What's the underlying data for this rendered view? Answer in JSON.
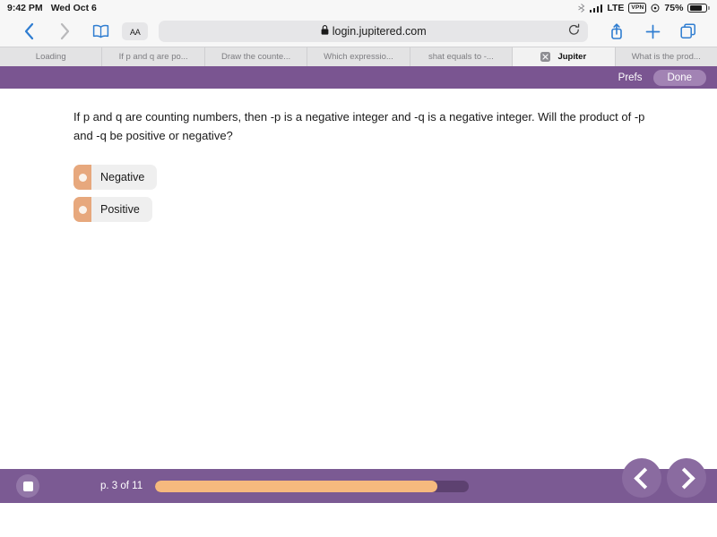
{
  "status_bar": {
    "time": "9:42 PM",
    "date": "Wed Oct 6",
    "network": "LTE",
    "vpn": "VPN",
    "battery_percent": "75%",
    "battery_level": 75
  },
  "browser": {
    "url": "login.jupitered.com",
    "text_size_label": "AA",
    "icons": {
      "back": "back-arrow-icon",
      "forward": "forward-arrow-icon",
      "bookmarks": "book-icon",
      "lock": "lock-icon",
      "reload": "reload-icon",
      "share": "share-icon",
      "new_tab": "plus-icon",
      "tabs": "tabs-icon"
    },
    "tabs": [
      {
        "label": "Loading",
        "active": false
      },
      {
        "label": "If p and q are po...",
        "active": false
      },
      {
        "label": "Draw the counte...",
        "active": false
      },
      {
        "label": "Which expressio...",
        "active": false
      },
      {
        "label": "shat equals to -...",
        "active": false
      },
      {
        "label": "Jupiter",
        "active": true
      },
      {
        "label": "What is the prod...",
        "active": false
      }
    ]
  },
  "app_header": {
    "prefs_label": "Prefs",
    "done_label": "Done"
  },
  "main": {
    "question": "If p and q are counting numbers, then -p is a negative integer and -q is a negative integer. Will the product of -p and -q be positive or negative?",
    "choices": [
      {
        "label": "Negative",
        "selected": false
      },
      {
        "label": "Positive",
        "selected": false
      }
    ]
  },
  "footer": {
    "page_indicator": "p. 3 of 11",
    "progress_percent": 90,
    "stop_icon": "stop-square-icon",
    "prev_icon": "chevron-left-icon",
    "next_icon": "chevron-right-icon"
  },
  "colors": {
    "header_purple": "#7a5591",
    "footer_purple": "#7b5a93",
    "accent_orange": "#e7a87d",
    "progress_orange": "#f6b97e",
    "browser_blue": "#2f7dd1"
  }
}
